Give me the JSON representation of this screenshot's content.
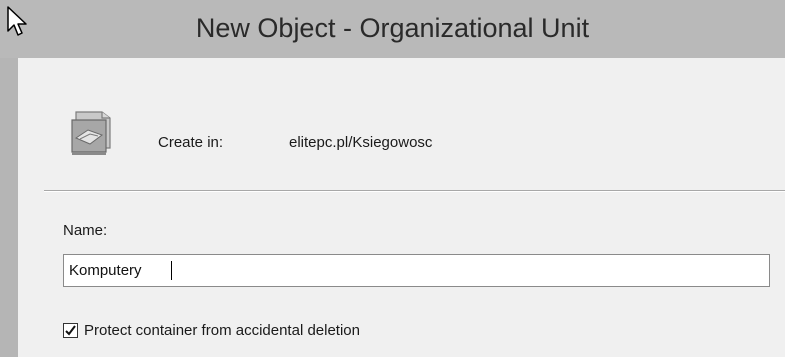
{
  "window": {
    "title": "New Object - Organizational Unit"
  },
  "header": {
    "create_in_label": "Create in:",
    "create_in_path": "elitepc.pl/Ksiegowosc",
    "icon": "organizational-unit-icon"
  },
  "form": {
    "name_label": "Name:",
    "name_value": "Komputery",
    "protect_checkbox": {
      "label": "Protect container from accidental deletion",
      "checked": true
    }
  },
  "colors": {
    "titlebar": "#b9b9b9",
    "client": "#f0f0f0"
  }
}
